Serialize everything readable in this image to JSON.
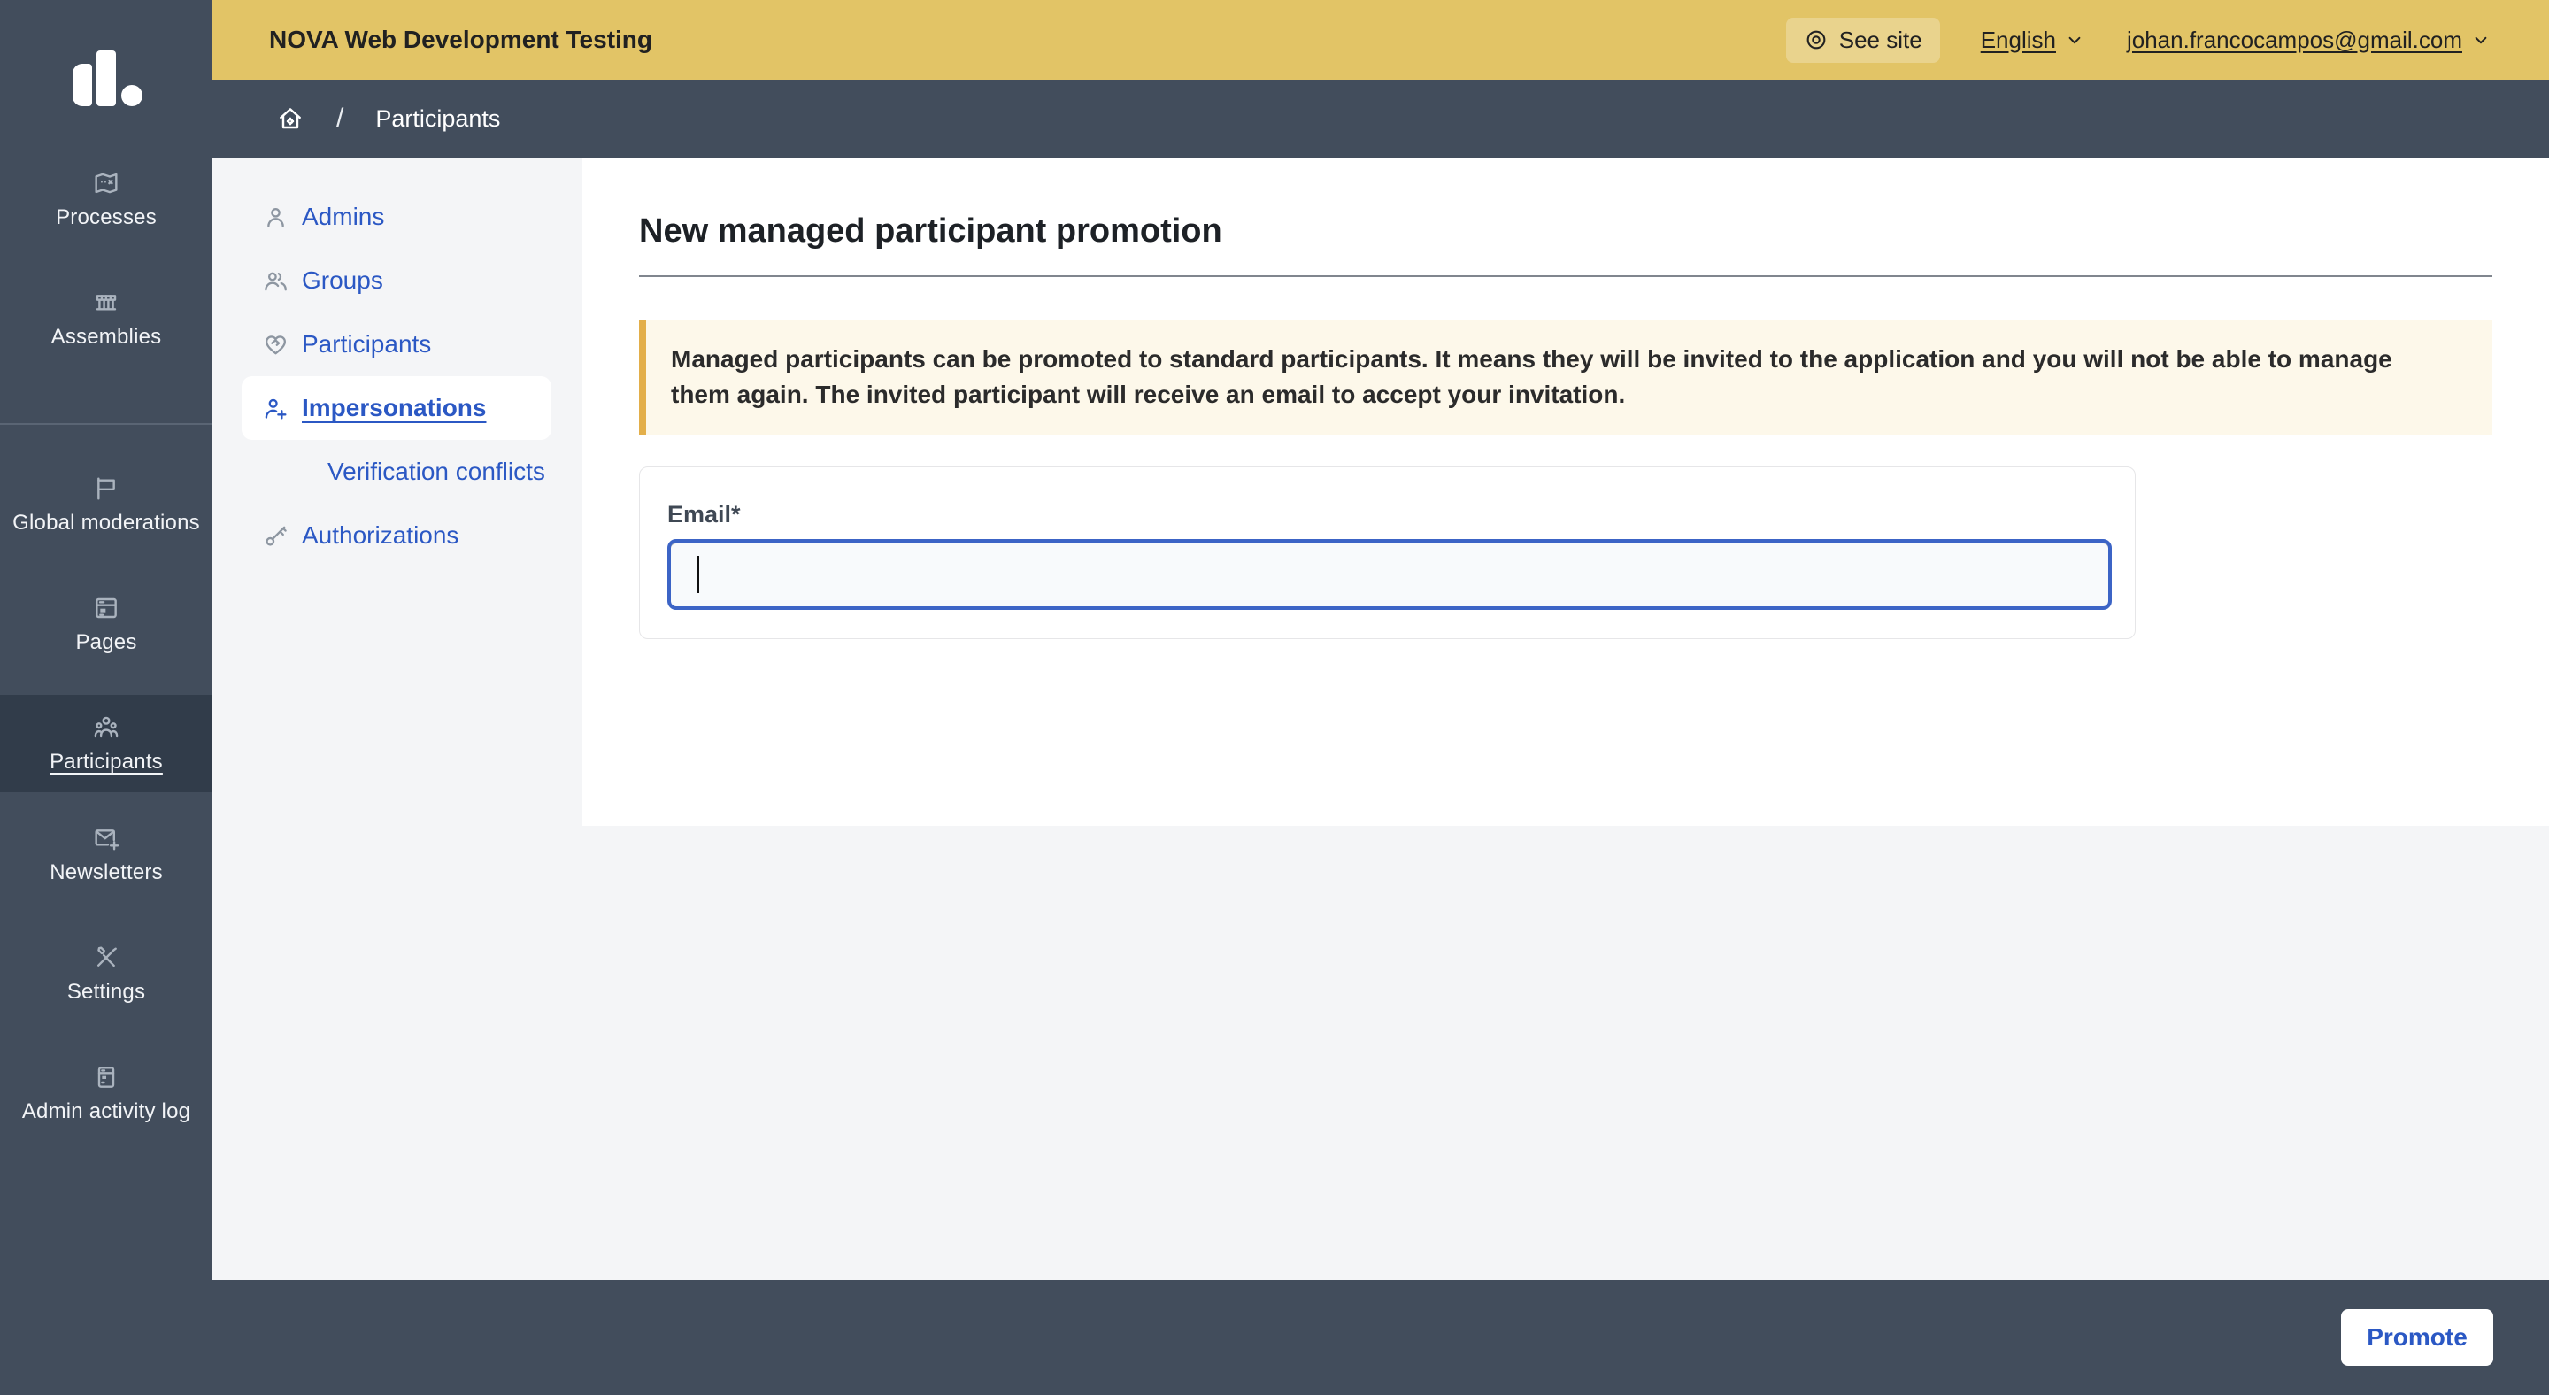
{
  "topbar": {
    "org_name": "NOVA Web Development Testing",
    "see_site_label": "See site",
    "language_label": "English",
    "user_email": "johan.francocampos@gmail.com"
  },
  "breadcrumb": {
    "separator": "/",
    "current": "Participants"
  },
  "sidebar": {
    "items": [
      {
        "label": "Processes",
        "icon": "map-icon",
        "active": false
      },
      {
        "label": "Assemblies",
        "icon": "building-icon",
        "active": false
      },
      {
        "label": "Global moderations",
        "icon": "flag-icon",
        "active": false
      },
      {
        "label": "Pages",
        "icon": "page-icon",
        "active": false
      },
      {
        "label": "Participants",
        "icon": "team-icon",
        "active": true
      },
      {
        "label": "Newsletters",
        "icon": "mail-add-icon",
        "active": false
      },
      {
        "label": "Settings",
        "icon": "tools-icon",
        "active": false
      },
      {
        "label": "Admin activity log",
        "icon": "activity-log-icon",
        "active": false
      }
    ]
  },
  "subnav": {
    "items": [
      {
        "label": "Admins",
        "icon": "person-icon",
        "active": false
      },
      {
        "label": "Groups",
        "icon": "group-icon",
        "active": false
      },
      {
        "label": "Participants",
        "icon": "heart-icon",
        "active": false
      },
      {
        "label": "Impersonations",
        "icon": "person-add-icon",
        "active": true
      },
      {
        "label": "Verification conflicts",
        "icon": "",
        "active": false
      },
      {
        "label": "Authorizations",
        "icon": "key-icon",
        "active": false
      }
    ]
  },
  "main": {
    "title": "New managed participant promotion",
    "callout_text": "Managed participants can be promoted to standard participants. It means they will be invited to the application and you will not be able to manage them again. The invited participant will receive an email to accept your invitation.",
    "form": {
      "email_label": "Email*",
      "email_value": "",
      "email_placeholder": ""
    },
    "promote_label": "Promote"
  },
  "colors": {
    "topbar_yellow": "#e2c466",
    "slate": "#424d5c",
    "slate_active": "#313c4a",
    "link_blue": "#2b58c4",
    "callout_bg": "#fdf8ea",
    "callout_border": "#e3af4a",
    "input_focus_border": "#3c64c6",
    "content_bg": "#f4f5f7"
  }
}
